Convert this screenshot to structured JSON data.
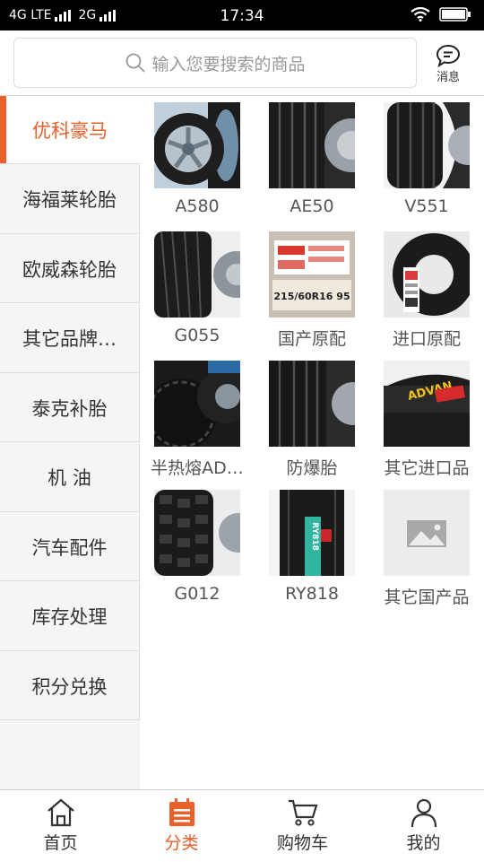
{
  "status_bar": {
    "network1": "4G LTE",
    "network2": "2G",
    "time": "17:34"
  },
  "search": {
    "placeholder": "输入您要搜索的商品"
  },
  "messages": {
    "label": "消息",
    "icon": "chat-bubble-icon"
  },
  "sidebar": {
    "items": [
      {
        "label": "优科豪马",
        "active": true
      },
      {
        "label": "海福莱轮胎"
      },
      {
        "label": "欧威森轮胎"
      },
      {
        "label": "其它品牌…"
      },
      {
        "label": "泰克补胎"
      },
      {
        "label": "机 油"
      },
      {
        "label": "汽车配件"
      },
      {
        "label": "库存处理"
      },
      {
        "label": "积分兑换"
      }
    ]
  },
  "products": [
    {
      "label": "A580",
      "image": "tire-with-alloy-wheel"
    },
    {
      "label": "AE50",
      "image": "tire-tread"
    },
    {
      "label": "V551",
      "image": "tire-tread"
    },
    {
      "label": "G055",
      "image": "tire-tread"
    },
    {
      "label": "国产原配",
      "image": "tire-label",
      "sticker": "215/60R16 95"
    },
    {
      "label": "进口原配",
      "image": "tire-with-tag"
    },
    {
      "label": "半热熔AD…",
      "image": "stacked-tires"
    },
    {
      "label": "防爆胎",
      "image": "tire-tread"
    },
    {
      "label": "其它进口品",
      "image": "advan-tire",
      "brand": "ADVAN"
    },
    {
      "label": "G012",
      "image": "all-terrain-tire"
    },
    {
      "label": "RY818",
      "image": "van-tire",
      "brand": "RY818"
    },
    {
      "label": "其它国产品",
      "image": "image-placeholder-icon"
    }
  ],
  "bottom_nav": {
    "items": [
      {
        "label": "首页",
        "icon": "home-icon"
      },
      {
        "label": "分类",
        "icon": "category-icon",
        "active": true
      },
      {
        "label": "购物车",
        "icon": "cart-icon"
      },
      {
        "label": "我的",
        "icon": "user-icon"
      }
    ]
  },
  "colors": {
    "accent": "#e8612c",
    "sidebar_bg": "#f5f5f5"
  }
}
